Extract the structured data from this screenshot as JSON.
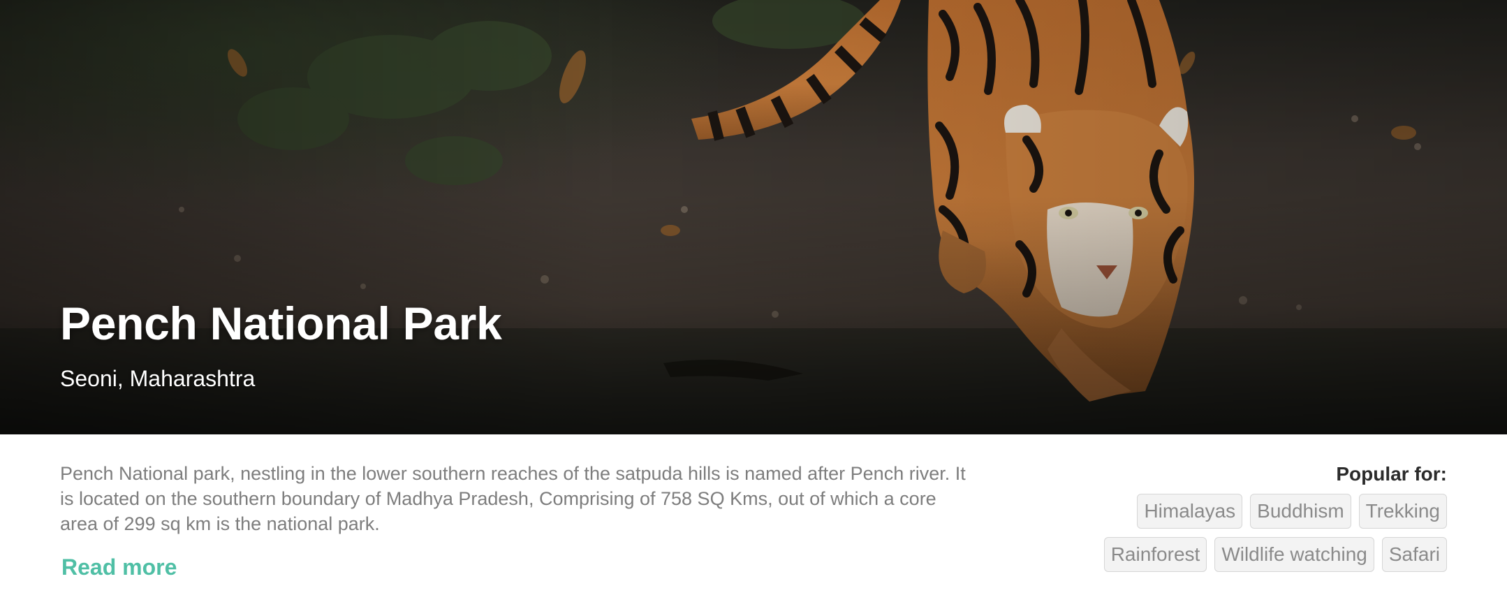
{
  "hero": {
    "image": "tiger-drinking-water-photo",
    "title": "Pench National Park",
    "subtitle": "Seoni, Maharashtra"
  },
  "description": "Pench National park, nestling in the lower southern reaches of the satpuda hills is named after Pench river. It is located on the southern boundary of Madhya Pradesh, Comprising of 758 SQ Kms, out of which a core area of 299 sq km is the national park.",
  "read_more_label": "Read more",
  "popular": {
    "label": "Popular for:",
    "tags_row1": [
      "Himalayas",
      "Buddhism",
      "Trekking"
    ],
    "tags_row2": [
      "Rainforest",
      "Wildlife watching",
      "Safari"
    ]
  },
  "colors": {
    "accent": "#4fbfa5",
    "body_text": "#7d7d7d",
    "tag_background": "#f3f3f3",
    "tag_border": "#d6d6d6"
  }
}
